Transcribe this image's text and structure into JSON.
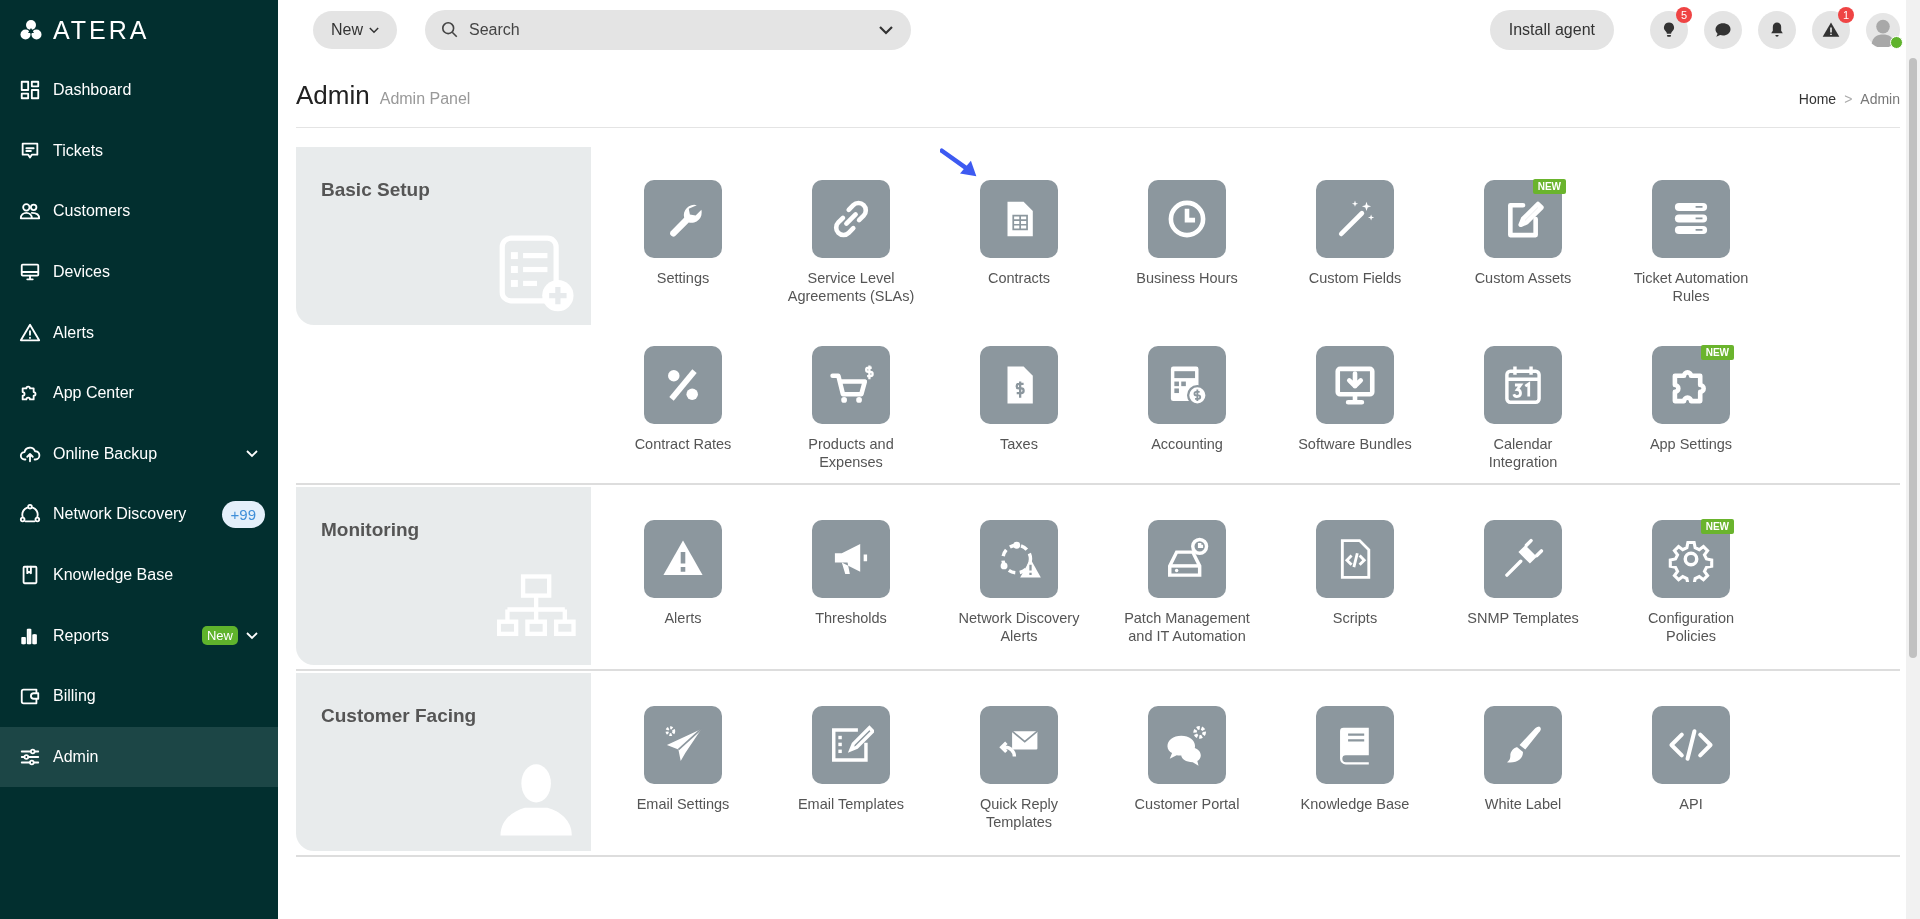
{
  "logo": {
    "text": "ATERA"
  },
  "sidebar": {
    "items": [
      {
        "label": "Dashboard",
        "selected": false,
        "expandable": false
      },
      {
        "label": "Tickets",
        "selected": false,
        "expandable": false
      },
      {
        "label": "Customers",
        "selected": false,
        "expandable": false
      },
      {
        "label": "Devices",
        "selected": false,
        "expandable": false
      },
      {
        "label": "Alerts",
        "selected": false,
        "expandable": false
      },
      {
        "label": "App Center",
        "selected": false,
        "expandable": false
      },
      {
        "label": "Online Backup",
        "selected": false,
        "expandable": true
      },
      {
        "label": "Network Discovery",
        "selected": false,
        "expandable": false,
        "badge": {
          "kind": "count",
          "text": "+99"
        }
      },
      {
        "label": "Knowledge Base",
        "selected": false,
        "expandable": false
      },
      {
        "label": "Reports",
        "selected": false,
        "expandable": true,
        "badge": {
          "kind": "new",
          "text": "New"
        }
      },
      {
        "label": "Billing",
        "selected": false,
        "expandable": false
      },
      {
        "label": "Admin",
        "selected": true,
        "expandable": false
      }
    ]
  },
  "topbar": {
    "new_button": "New",
    "search": {
      "placeholder": "Search"
    },
    "install_button": "Install agent",
    "lightbulb_badge": "5",
    "warning_badge": "1",
    "avatar": {
      "online": true
    }
  },
  "header": {
    "title": "Admin",
    "subtitle": "Admin Panel",
    "breadcrumb": [
      "Home",
      ">",
      "Admin"
    ]
  },
  "sections": [
    {
      "title": "Basic Setup",
      "items": [
        {
          "label": "Settings",
          "pointed": false
        },
        {
          "label": "Service Level Agreements (SLAs)",
          "pointed": false
        },
        {
          "label": "Contracts",
          "pointed": true
        },
        {
          "label": "Business Hours",
          "pointed": false
        },
        {
          "label": "Custom Fields",
          "pointed": false
        },
        {
          "label": "Custom Assets",
          "pointed": false,
          "badge": "NEW"
        },
        {
          "label": "Ticket Automation Rules",
          "pointed": false
        },
        {
          "label": "Contract Rates",
          "pointed": false
        },
        {
          "label": "Products and Expenses",
          "pointed": false
        },
        {
          "label": "Taxes",
          "pointed": false
        },
        {
          "label": "Accounting",
          "pointed": false
        },
        {
          "label": "Software Bundles",
          "pointed": false
        },
        {
          "label": "Calendar Integration",
          "pointed": false
        },
        {
          "label": "App Settings",
          "pointed": false,
          "badge": "NEW"
        }
      ]
    },
    {
      "title": "Monitoring",
      "items": [
        {
          "label": "Alerts",
          "pointed": false
        },
        {
          "label": "Thresholds",
          "pointed": false
        },
        {
          "label": "Network Discovery Alerts",
          "pointed": false
        },
        {
          "label": "Patch Management and IT Automation",
          "pointed": false
        },
        {
          "label": "Scripts",
          "pointed": false
        },
        {
          "label": "SNMP Templates",
          "pointed": false
        },
        {
          "label": "Configuration Policies",
          "pointed": false,
          "badge": "NEW"
        }
      ]
    },
    {
      "title": "Customer Facing",
      "items": [
        {
          "label": "Email Settings",
          "pointed": false
        },
        {
          "label": "Email Templates",
          "pointed": false
        },
        {
          "label": "Quick Reply Templates",
          "pointed": false
        },
        {
          "label": "Customer Portal",
          "pointed": false
        },
        {
          "label": "Knowledge Base",
          "pointed": false
        },
        {
          "label": "White Label",
          "pointed": false
        },
        {
          "label": "API",
          "pointed": false
        }
      ]
    }
  ]
}
